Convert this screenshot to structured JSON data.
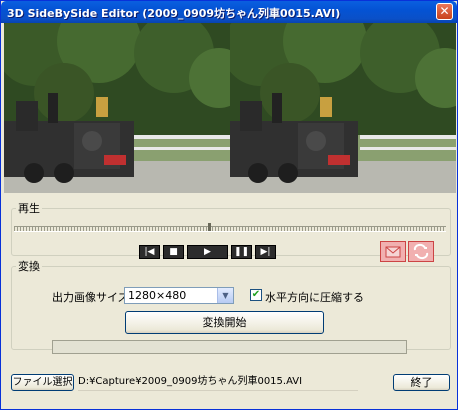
{
  "window": {
    "title": "3D SideBySide Editor (2009_0909坊ちゃん列車0015.AVI)",
    "close_symbol": "✕"
  },
  "icons": {
    "prev": "prev-icon",
    "stop": "stop-icon",
    "play": "play-icon",
    "pause": "pause-icon",
    "next": "next-icon",
    "mode_side": "mail-envelope-icon",
    "mode_swap": "swap-arrows-icon"
  },
  "playback": {
    "legend": "再生",
    "prev_symbol": "|◀",
    "stop_symbol": "■",
    "play_symbol": "▶",
    "pause_symbol": "❚❚",
    "next_symbol": "▶|",
    "seek_position": 0.45
  },
  "convert": {
    "legend": "変換",
    "size_label": "出力画像サイズ:",
    "size_value": "1280×480",
    "dropdown_symbol": "▼",
    "compress_label": "水平方向に圧縮する",
    "compress_checked_symbol": "✔",
    "start_label": "変換開始",
    "progress": 0
  },
  "footer": {
    "file_button": "ファイル選択",
    "file_path": "D:¥Capture¥2009_0909坊ちゃん列車0015.AVI",
    "exit_label": "終了"
  },
  "colors": {
    "titlebar": "#0a50c8",
    "mode_button_bg": "#f1b0b0",
    "media_button_bg": "#2c2c2c"
  }
}
